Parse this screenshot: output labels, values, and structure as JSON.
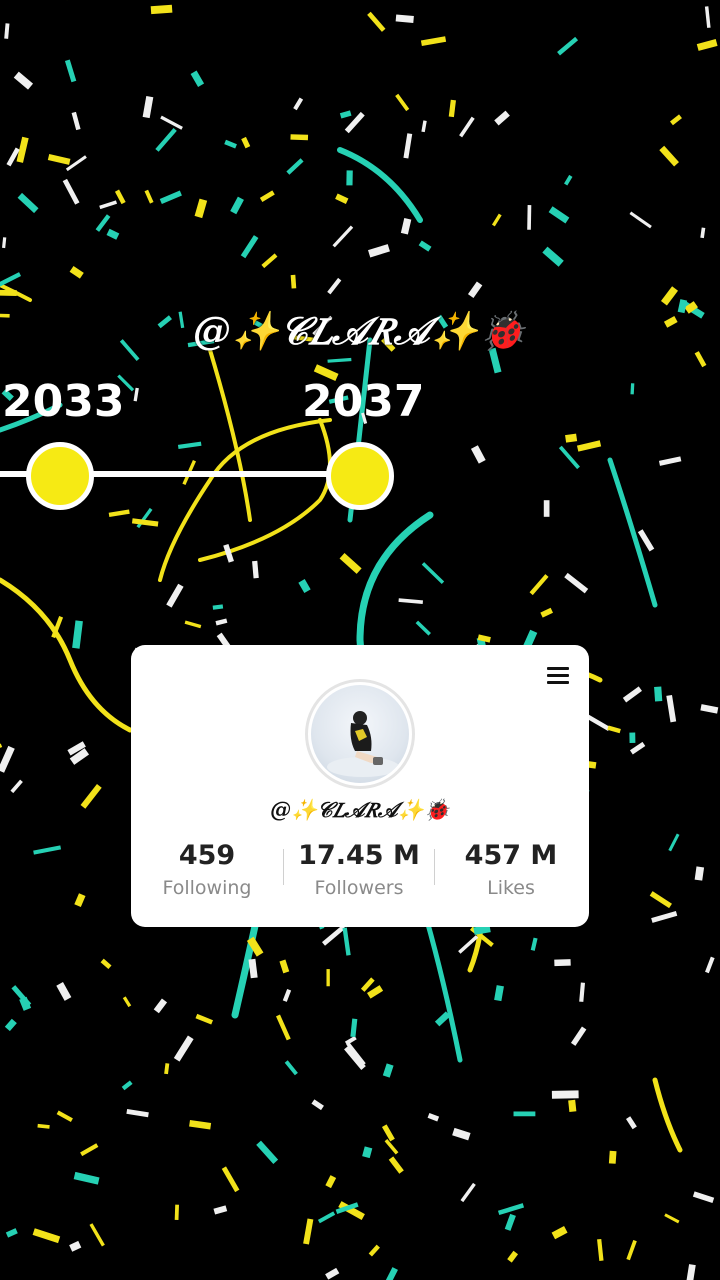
{
  "overlay": {
    "handle": "@✨𝒞𝐿𝒜𝑅𝒜✨🐞"
  },
  "timeline": {
    "years": [
      "2033",
      "2037"
    ],
    "dot_color": "#f6ea14"
  },
  "profile_card": {
    "handle": "@✨𝒞𝐿𝒜𝑅𝒜✨🐞",
    "menu_icon": "hamburger-menu-icon",
    "stats": [
      {
        "value": "459",
        "label": "Following"
      },
      {
        "value": "17.45 M",
        "label": "Followers"
      },
      {
        "value": "457 M",
        "label": "Likes"
      }
    ]
  },
  "colors": {
    "background": "#000000",
    "confetti_yellow": "#f2e21a",
    "confetti_teal": "#26d1b4",
    "confetti_white": "#f0f0f0"
  }
}
